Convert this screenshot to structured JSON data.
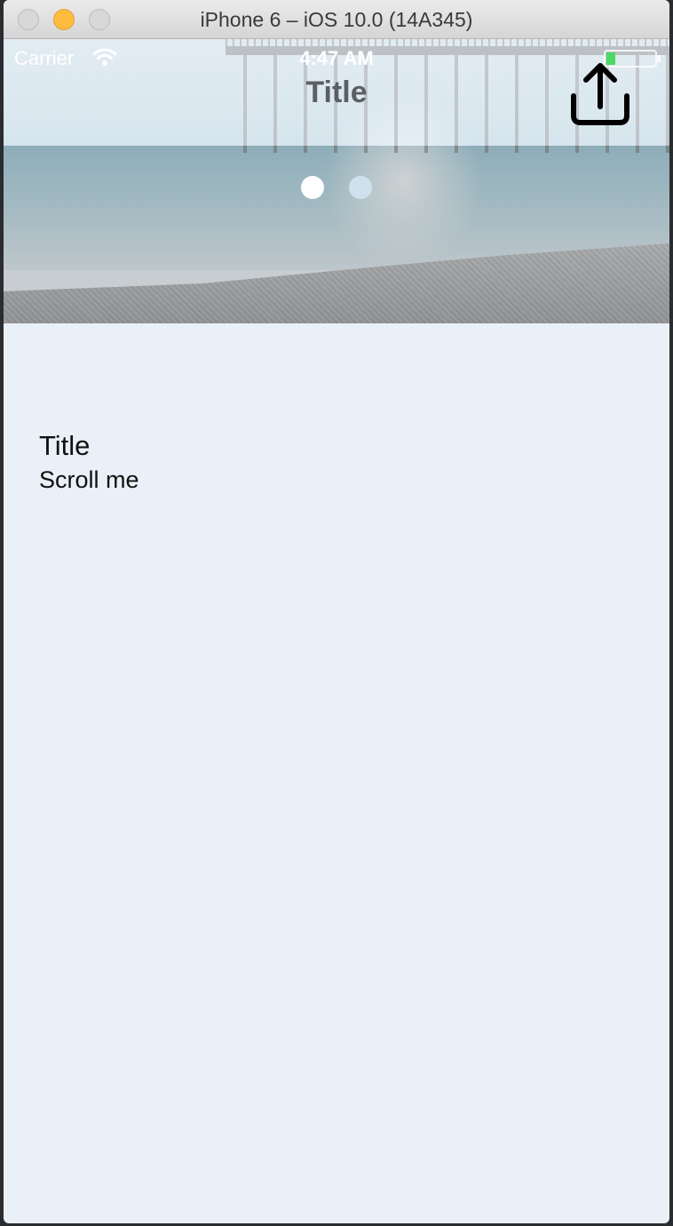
{
  "window": {
    "title": "iPhone 6 – iOS 10.0 (14A345)"
  },
  "status_bar": {
    "carrier": "Carrier",
    "time": "4:47 AM",
    "wifi_icon": "wifi-icon",
    "battery_icon": "battery-icon"
  },
  "nav_bar": {
    "title": "Title",
    "share_icon": "share-icon"
  },
  "page_control": {
    "pages": 2,
    "current_page": 1
  },
  "content": {
    "title": "Title",
    "subtitle": "Scroll me"
  },
  "colors": {
    "background": "#e9f0f7",
    "nav_title": "#5b5f63",
    "dot_active": "#ffffff",
    "dot_inactive": "#d2e4f0",
    "minimize_button": "#fdbc40"
  }
}
